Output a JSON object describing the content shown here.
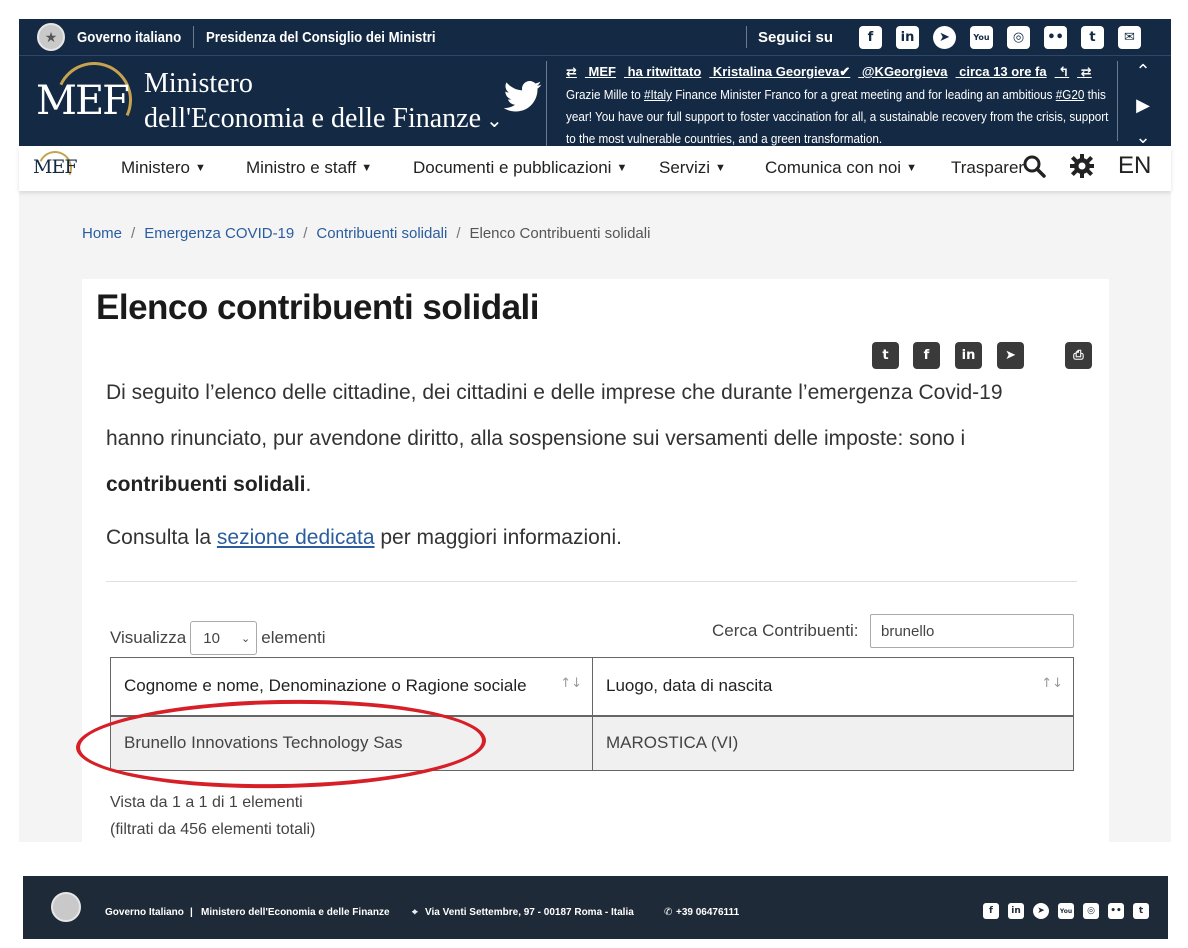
{
  "topbar": {
    "gov": "Governo italiano",
    "presidency": "Presidenza del Consiglio dei Ministri",
    "follow": "Seguici su",
    "social_icons": [
      "facebook-icon",
      "linkedin-icon",
      "telegram-icon",
      "youtube-icon",
      "instagram-icon",
      "flickr-icon",
      "twitter-icon",
      "email-icon"
    ]
  },
  "header": {
    "logo_text": "MEF",
    "title_line1": "Ministero",
    "title_line2": "dell'Economia e delle Finanze",
    "tweet": {
      "account": "MEF",
      "action": "ha ritwittato",
      "retweeted_name": "Kristalina Georgieva✔",
      "handle": "@KGeorgieva",
      "time": "circa 13 ore fa",
      "text_before": "Grazie Mille to ",
      "hashtag1": "#Italy",
      "text_middle": " Finance Minister Franco for a great meeting and for leading an ambitious ",
      "hashtag2": "#G20",
      "text_after": " this year! You have our full support to foster vaccination for all, a sustainable recovery from the crisis, support to the most vulnerable countries, and a green transformation."
    }
  },
  "nav": {
    "logo_text": "MEF",
    "items": [
      {
        "label": "Ministero"
      },
      {
        "label": "Ministro e staff"
      },
      {
        "label": "Documenti e pubblicazioni"
      },
      {
        "label": "Servizi"
      },
      {
        "label": "Comunica con noi"
      },
      {
        "label": "Trasparer"
      }
    ],
    "lang": "EN"
  },
  "breadcrumb": [
    "Home",
    "Emergenza COVID-19",
    "Contribuenti solidali",
    "Elenco Contribuenti solidali"
  ],
  "page": {
    "title": "Elenco contribuenti solidali",
    "intro_text": "Di seguito l’elenco delle cittadine, dei cittadini e delle imprese che durante l’emergenza Covid-19 hanno rinunciato, pur avendone diritto, alla sospensione sui versamenti delle imposte: sono i ",
    "intro_bold": "contribuenti solidali",
    "intro_end": ".",
    "consult_before": "Consulta la ",
    "consult_link": "sezione dedicata",
    "consult_after": " per maggiori informazioni."
  },
  "table_controls": {
    "show_label": "Visualizza",
    "show_value": "10",
    "show_suffix": "elementi",
    "search_label": "Cerca Contribuenti:",
    "search_value": "brunello"
  },
  "table": {
    "headers": [
      "Cognome e nome, Denominazione o Ragione sociale",
      "Luogo, data di nascita"
    ],
    "rows": [
      [
        "Brunello Innovations Technology Sas",
        "MAROSTICA (VI)"
      ]
    ]
  },
  "info": {
    "line1": "Vista da 1 a 1 di 1 elementi",
    "line2": "(filtrati da 456 elementi totali)"
  },
  "footer": {
    "gov": "Governo Italiano",
    "sep": "|",
    "ministry": "Ministero dell'Economia e delle Finanze",
    "address": "Via Venti Settembre, 97 - 00187 Roma - Italia",
    "phone": "+39 06476111"
  },
  "colors": {
    "header_bg": "#142a44",
    "link": "#2a5d9f",
    "highlight_oval": "#d61f26",
    "footer_bg": "#1f2a38"
  }
}
